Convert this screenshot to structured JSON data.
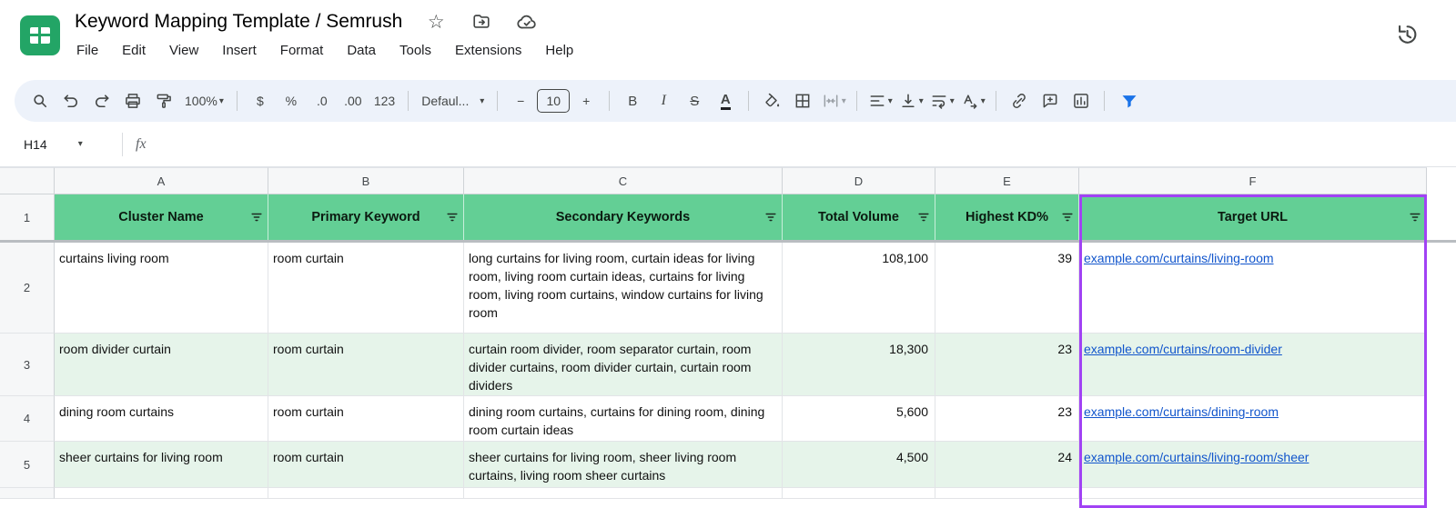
{
  "header": {
    "title": "Keyword Mapping Template / Semrush",
    "menu_items": [
      "File",
      "Edit",
      "View",
      "Insert",
      "Format",
      "Data",
      "Tools",
      "Extensions",
      "Help"
    ]
  },
  "glyphs": {
    "chevron_down": "▾",
    "star_outline": "☆"
  },
  "toolbar": {
    "zoom_value": "100%",
    "format_currency": "$",
    "format_percent": "%",
    "decrease_decimals": ".0",
    "increase_decimals": ".00",
    "more_formats": "123",
    "font_name": "Defaul...",
    "minus": "−",
    "font_size": "10",
    "plus": "+",
    "bold": "B",
    "italic": "I",
    "strikethrough": "S",
    "text_color": "A",
    "icon_names": [
      "search",
      "undo",
      "redo",
      "print",
      "paint-format",
      "fill-color",
      "borders",
      "merge-cells",
      "horizontal-align",
      "vertical-align",
      "text-wrap",
      "text-rotation",
      "insert-link",
      "insert-comment",
      "insert-chart",
      "create-filter"
    ]
  },
  "formula_bar": {
    "name_box": "H14",
    "fx": "fx"
  },
  "sheet": {
    "column_letters": [
      "A",
      "B",
      "C",
      "D",
      "E",
      "F"
    ],
    "row_numbers": [
      "1",
      "2",
      "3",
      "4",
      "5"
    ],
    "headers": [
      "Cluster Name",
      "Primary Keyword",
      "Secondary Keywords",
      "Total Volume",
      "Highest KD%",
      "Target URL"
    ],
    "rows": [
      {
        "cluster": "curtains living room",
        "primary": "room curtain",
        "secondary": "long curtains for living room, curtain ideas for living room, living room curtain ideas, curtains for living room, living room curtains, window curtains for living room",
        "volume": "108,100",
        "kd": "39",
        "url": "example.com/curtains/living-room"
      },
      {
        "cluster": "room divider curtain",
        "primary": "room curtain",
        "secondary": "curtain room divider, room separator curtain, room divider curtains, room divider curtain, curtain room dividers",
        "volume": "18,300",
        "kd": "23",
        "url": "example.com/curtains/room-divider"
      },
      {
        "cluster": "dining room curtains",
        "primary": "room curtain",
        "secondary": "dining room curtains, curtains for dining room, dining room curtain ideas",
        "volume": "5,600",
        "kd": "23",
        "url": "example.com/curtains/dining-room"
      },
      {
        "cluster": "sheer curtains for living room",
        "primary": "room curtain",
        "secondary": "sheer curtains for living room, sheer living room curtains, living room sheer curtains",
        "volume": "4,500",
        "kd": "24",
        "url": "example.com/curtains/living-room/sheer"
      }
    ]
  },
  "colors": {
    "header_green": "#63cf95",
    "band_green": "#e6f4ea",
    "selection_purple": "#a142f4",
    "link_blue": "#1155cc",
    "toolbar_bg": "#edf2fa",
    "filter_blue": "#1a73e8"
  }
}
